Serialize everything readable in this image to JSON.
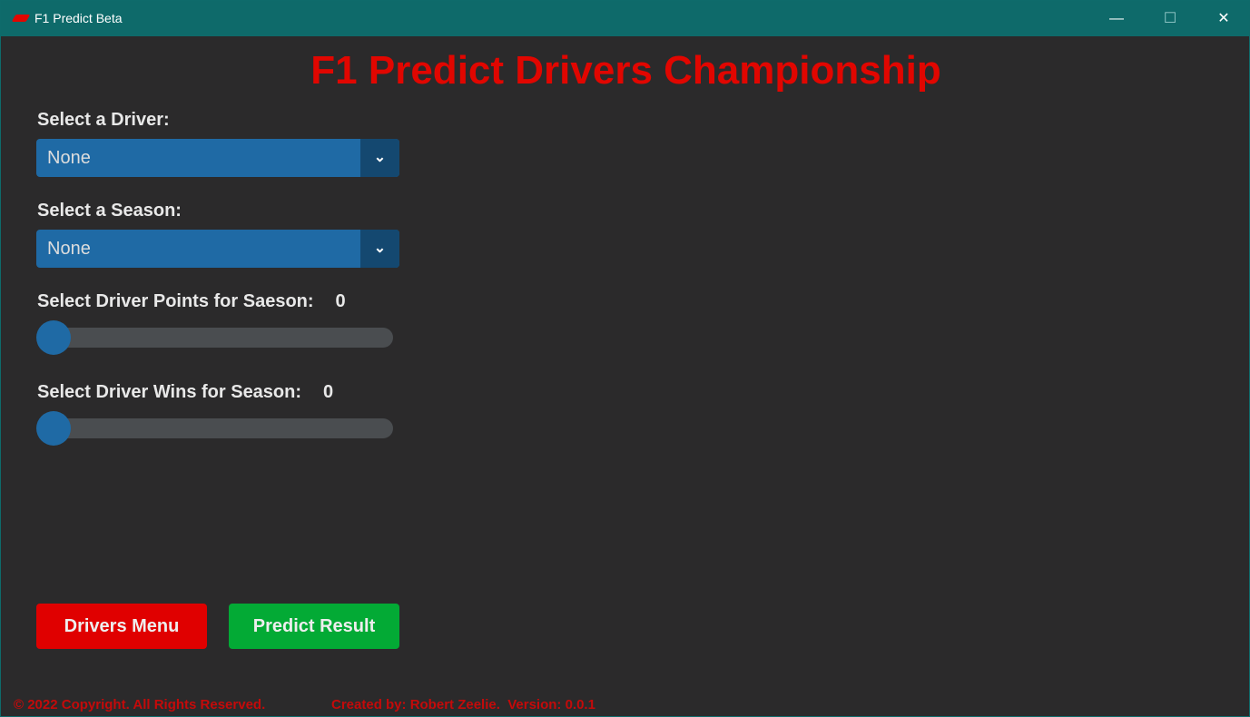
{
  "window": {
    "title": "F1 Predict Beta",
    "minimize": "—",
    "maximize": "☐",
    "close": "✕"
  },
  "heading": "F1 Predict Drivers Championship",
  "driver": {
    "label": "Select a Driver:",
    "value": "None",
    "arrow": "⌄"
  },
  "season": {
    "label": "Select a Season:",
    "value": "None",
    "arrow": "⌄"
  },
  "points": {
    "label": "Select Driver Points for Saeson:",
    "value": "0"
  },
  "wins": {
    "label": "Select Driver Wins for Season:",
    "value": "0"
  },
  "buttons": {
    "drivers_menu": "Drivers Menu",
    "predict": "Predict Result"
  },
  "footer": {
    "copyright": "© 2022 Copyright. All Rights Reserved.",
    "credit": "Created by: Robert Zeelie.  Version: 0.0.1"
  }
}
